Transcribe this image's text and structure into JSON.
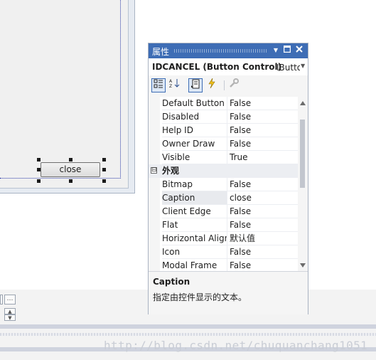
{
  "designer": {
    "close_button_label": "close"
  },
  "properties": {
    "title": "属性",
    "object_name": "IDCANCEL (Button Control)",
    "object_type": "IButton",
    "icons": {
      "dropdown": "pin-dropdown-icon",
      "maximize": "maximize-icon",
      "close": "close-icon"
    },
    "rows": [
      {
        "name": "Default Button",
        "value": "False"
      },
      {
        "name": "Disabled",
        "value": "False"
      },
      {
        "name": "Help ID",
        "value": "False"
      },
      {
        "name": "Owner Draw",
        "value": "False"
      },
      {
        "name": "Visible",
        "value": "True"
      }
    ],
    "category": {
      "label": "外观",
      "toggle": "⊟"
    },
    "rows2": [
      {
        "name": "Bitmap",
        "value": "False"
      },
      {
        "name": "Caption",
        "value": "close"
      },
      {
        "name": "Client Edge",
        "value": "False"
      },
      {
        "name": "Flat",
        "value": "False"
      },
      {
        "name": "Horizontal Alignment",
        "value": "默认值"
      },
      {
        "name": "Icon",
        "value": "False"
      },
      {
        "name": "Modal Frame",
        "value": "False"
      }
    ],
    "description": {
      "title": "Caption",
      "text": "指定由控件显示的文本。"
    }
  },
  "watermark": "http://blog.csdn.net/chuquanchang1051"
}
